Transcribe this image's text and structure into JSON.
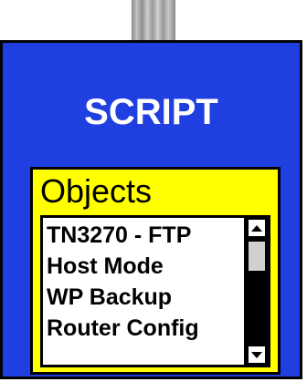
{
  "panel": {
    "title": "SCRIPT",
    "background_color": "#1f3fe0",
    "group": {
      "label": "Objects",
      "background_color": "#ffff00",
      "list": {
        "items": [
          "TN3270 - FTP",
          "Host Mode",
          "WP Backup",
          "Router Config"
        ]
      }
    }
  }
}
